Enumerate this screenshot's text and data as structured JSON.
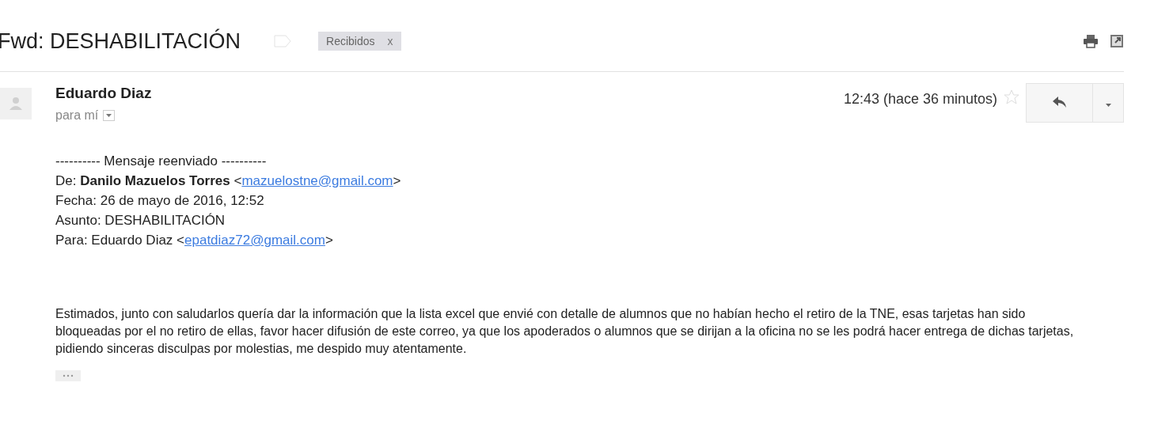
{
  "subject": "Fwd: DESHABILITACIÓN",
  "important": false,
  "labels": [
    {
      "label": "Recibidos",
      "close": "x"
    }
  ],
  "message": {
    "sender": "Eduardo Diaz",
    "recipient": "para mí",
    "time": "12:43 (hace 36 minutos)",
    "starred": false,
    "forwarded": {
      "separator": "---------- Mensaje reenviado ----------",
      "lines": [
        {
          "text": "De: **Danilo Mazuelos Torres** <",
          "email": "mazuelostne@gmail.com",
          "suffix": ">"
        },
        {
          "text": "Fecha: 26 de mayo de 2016, 12:52"
        },
        {
          "text": "Asunto: DESHABILITACIÓN"
        },
        {
          "text": "Para: Eduardo Diaz <",
          "email": "epatdiaz72@gmail.com",
          "suffix": ">"
        }
      ]
    },
    "body": "Estimados, junto con saludarlos quería dar la información que la lista excel que envié con detalle de alumnos que no habían hecho el retiro de la TNE, esas tarjetas han sido bloqueadas por el no retiro de ellas, favor hacer difusión de este correo, ya que los apoderados o alumnos que se dirijan a la oficina no se les podrá hacer entrega de dichas tarjetas, pidiendo sinceras disculpas por molestias, me despido muy atentamente."
  }
}
